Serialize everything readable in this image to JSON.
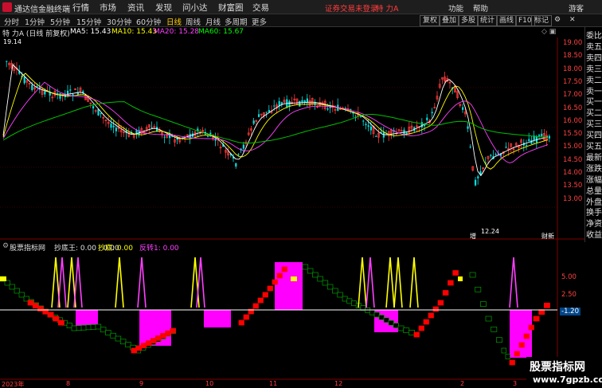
{
  "titlebar": {
    "app_name": "通达信金融终端",
    "menus": [
      "行情",
      "市场",
      "资讯",
      "发现",
      "问小达",
      "财富圈",
      "交易"
    ],
    "trade_tip": "证券交易未登录",
    "stock_name": "特 力A",
    "right_menus": [
      "功能",
      "帮助",
      "游客"
    ]
  },
  "toolbar": {
    "periods": [
      "分时",
      "1分钟",
      "5分钟",
      "15分钟",
      "30分钟",
      "60分钟",
      "日线",
      "周线",
      "月线",
      "多周期",
      "更多"
    ],
    "active_period": "日线",
    "buttons": [
      "复权",
      "叠加",
      "多股",
      "统计",
      "画线",
      "F10",
      "标记"
    ]
  },
  "ma_info": {
    "title": "特 力A (日线 前复权)",
    "ma5": "MA5: 15.43",
    "ma10": "MA10: 15.43",
    "ma20": "MA20: 15.28",
    "ma60": "MA60: 15.67",
    "ma5_color": "#ffffff",
    "ma10_color": "#ffff00",
    "ma20_color": "#ff40ff",
    "ma60_color": "#00ff00"
  },
  "price_labels": {
    "high": "19.14",
    "low": "12.24",
    "low_tag": "增",
    "right_tag": "财新"
  },
  "price_axis": [
    "19.00",
    "18.50",
    "18.00",
    "17.50",
    "17.00",
    "16.50",
    "16.00",
    "15.50",
    "15.00",
    "14.50",
    "14.00",
    "13.50",
    "13.00"
  ],
  "side_panel": [
    "委比",
    "卖五",
    "卖四",
    "卖三",
    "卖二",
    "卖一",
    "买一",
    "买二",
    "买三",
    "买四",
    "买五",
    "最新",
    "涨跌",
    "涨幅",
    "总量",
    "外盘",
    "换手",
    "净资",
    "收益"
  ],
  "indicator_info": {
    "name": "股票指标网",
    "f1": "抄底王: 0.00 : 0.00",
    "f2": "抄底: 0.00",
    "f3": "反转1: 0.00"
  },
  "sub_axis": [
    "5.00",
    "2.50",
    "-1.20"
  ],
  "date_axis": [
    "2023年",
    "8",
    "9",
    "10",
    "11",
    "12",
    "2",
    "3"
  ],
  "watermark": {
    "line1": "股票指标网",
    "line2": "www.7gpzb.com"
  }
}
